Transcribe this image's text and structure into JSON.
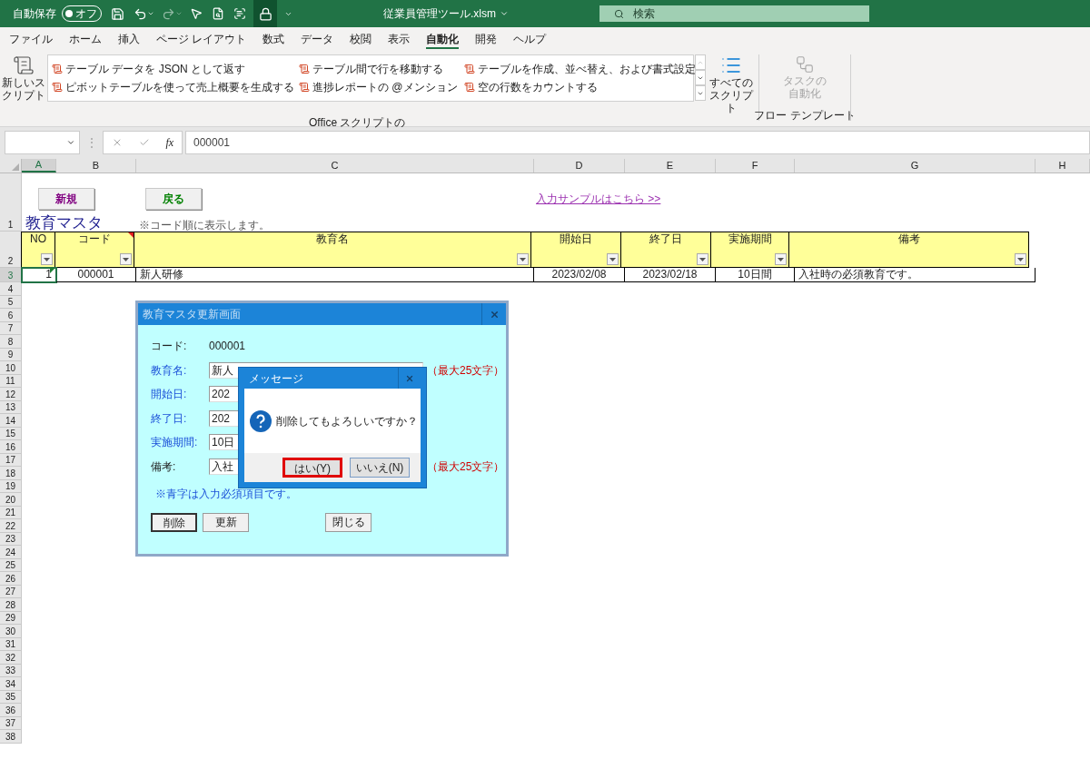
{
  "title_bar": {
    "autosave_label": "自動保存",
    "autosave_state": "オフ",
    "autosave_on": false,
    "file_name": "従業員管理ツール.xlsm",
    "search_placeholder": "検索"
  },
  "menu_tabs": [
    {
      "label": "ファイル",
      "selected": false
    },
    {
      "label": "ホーム",
      "selected": false
    },
    {
      "label": "挿入",
      "selected": false
    },
    {
      "label": "ページ レイアウト",
      "selected": false
    },
    {
      "label": "数式",
      "selected": false
    },
    {
      "label": "データ",
      "selected": false
    },
    {
      "label": "校閲",
      "selected": false
    },
    {
      "label": "表示",
      "selected": false
    },
    {
      "label": "自動化",
      "selected": true
    },
    {
      "label": "開発",
      "selected": false
    },
    {
      "label": "ヘルプ",
      "selected": false
    }
  ],
  "ribbon": {
    "new_script": "新しいスクリプト",
    "scripts": [
      "テーブル データを JSON として返す",
      "ピボットテーブルを使って売上概要を生成する",
      "テーブル間で行を移動する",
      "進捗レポートの @メンション",
      "テーブルを作成、並べ替え、および書式設定",
      "空の行数をカウントする"
    ],
    "scripts_group": "Office スクリプトの",
    "all_scripts": "すべてのスクリプト",
    "flow": {
      "label": "タスクの自動化",
      "disabled": true
    },
    "flow_group": "フロー テンプレート"
  },
  "formula_bar": {
    "separator": "⋮",
    "function_label": "fx",
    "value": "000001"
  },
  "columns": [
    {
      "label": "A",
      "selected": true
    },
    {
      "label": "B",
      "selected": false
    },
    {
      "label": "C",
      "selected": false
    },
    {
      "label": "D",
      "selected": false
    },
    {
      "label": "E",
      "selected": false
    },
    {
      "label": "F",
      "selected": false
    },
    {
      "label": "G",
      "selected": false
    },
    {
      "label": "H",
      "selected": false
    }
  ],
  "rows": [
    {
      "label": "1",
      "selected": false
    },
    {
      "label": "2",
      "selected": false
    },
    {
      "label": "3",
      "selected": true
    },
    {
      "label": "4",
      "selected": false
    },
    {
      "label": "5",
      "selected": false
    },
    {
      "label": "6",
      "selected": false
    },
    {
      "label": "7",
      "selected": false
    },
    {
      "label": "8",
      "selected": false
    },
    {
      "label": "9",
      "selected": false
    },
    {
      "label": "10",
      "selected": false
    },
    {
      "label": "11",
      "selected": false
    },
    {
      "label": "12",
      "selected": false
    },
    {
      "label": "13",
      "selected": false
    },
    {
      "label": "14",
      "selected": false
    },
    {
      "label": "15",
      "selected": false
    },
    {
      "label": "16",
      "selected": false
    },
    {
      "label": "17",
      "selected": false
    },
    {
      "label": "18",
      "selected": false
    },
    {
      "label": "19",
      "selected": false
    },
    {
      "label": "20",
      "selected": false
    },
    {
      "label": "21",
      "selected": false
    },
    {
      "label": "22",
      "selected": false
    },
    {
      "label": "23",
      "selected": false
    },
    {
      "label": "24",
      "selected": false
    },
    {
      "label": "25",
      "selected": false
    },
    {
      "label": "26",
      "selected": false
    },
    {
      "label": "27",
      "selected": false
    },
    {
      "label": "28",
      "selected": false
    },
    {
      "label": "29",
      "selected": false
    },
    {
      "label": "30",
      "selected": false
    },
    {
      "label": "31",
      "selected": false
    },
    {
      "label": "32",
      "selected": false
    },
    {
      "label": "33",
      "selected": false
    },
    {
      "label": "34",
      "selected": false
    },
    {
      "label": "35",
      "selected": false
    },
    {
      "label": "36",
      "selected": false
    },
    {
      "label": "37",
      "selected": false
    },
    {
      "label": "38",
      "selected": false
    }
  ],
  "sheet": {
    "buttons": [
      {
        "label": "新規",
        "color": "#800080"
      },
      {
        "label": "戻る",
        "color": "#008000"
      }
    ],
    "link": "入力サンプルはこちら >>",
    "title": "教育マスタ",
    "note": "※コード順に表示します。",
    "headers": [
      "NO",
      "コード",
      "教育名",
      "開始日",
      "終了日",
      "実施期間",
      "備考"
    ],
    "records": [
      [
        "1",
        "000001",
        "新人研修",
        "2023/02/08",
        "2023/02/18",
        "10日間",
        "入社時の必須教育です。"
      ]
    ]
  },
  "dialog": {
    "title": "教育マスタ更新画面",
    "code_label": "コード:",
    "code_value": "000001",
    "fields": [
      {
        "label": "教育名:",
        "value": "新人",
        "required": true,
        "hint": "（最大25文字）"
      },
      {
        "label": "開始日:",
        "value": "202",
        "required": true
      },
      {
        "label": "終了日:",
        "value": "202",
        "required": true
      },
      {
        "label": "実施期間:",
        "value": "10日",
        "required": true
      },
      {
        "label": "備考:",
        "value": "入社",
        "required": false,
        "hint": "（最大25文字）"
      }
    ],
    "note": "※青字は入力必須項目です。",
    "buttons": [
      {
        "label": "削除",
        "selected": true
      },
      {
        "label": "更新",
        "selected": false
      },
      {
        "label": "閉じる",
        "selected": false
      }
    ]
  },
  "message_box": {
    "title": "メッセージ",
    "text": "削除してもよろしいですか？",
    "buttons": [
      {
        "label": "はい(Y)",
        "selected": true
      },
      {
        "label": "いいえ(N)",
        "selected": false
      }
    ]
  }
}
